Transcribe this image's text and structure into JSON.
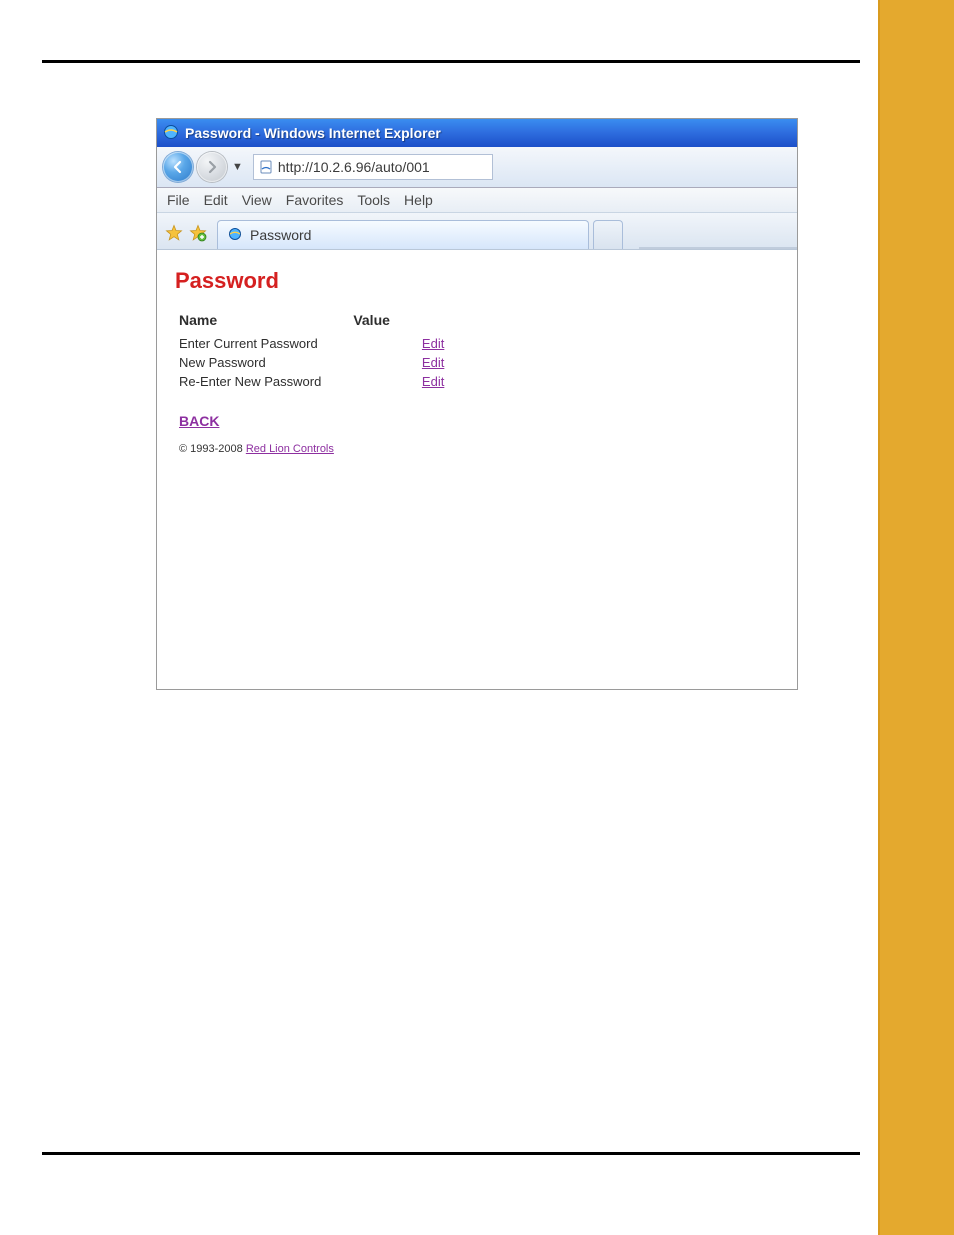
{
  "window": {
    "title": "Password - Windows Internet Explorer",
    "address": "http://10.2.6.96/auto/001",
    "tab_label": "Password"
  },
  "menu": {
    "items": [
      "File",
      "Edit",
      "View",
      "Favorites",
      "Tools",
      "Help"
    ]
  },
  "page": {
    "heading": "Password",
    "columns": {
      "name": "Name",
      "value": "Value"
    },
    "rows": [
      {
        "name": "Enter Current Password",
        "value": "",
        "action": "Edit"
      },
      {
        "name": "New Password",
        "value": "",
        "action": "Edit"
      },
      {
        "name": "Re-Enter New Password",
        "value": "",
        "action": "Edit"
      }
    ],
    "back_label": "BACK",
    "copyright_prefix": "© 1993-2008 ",
    "copyright_link": "Red Lion Controls"
  }
}
